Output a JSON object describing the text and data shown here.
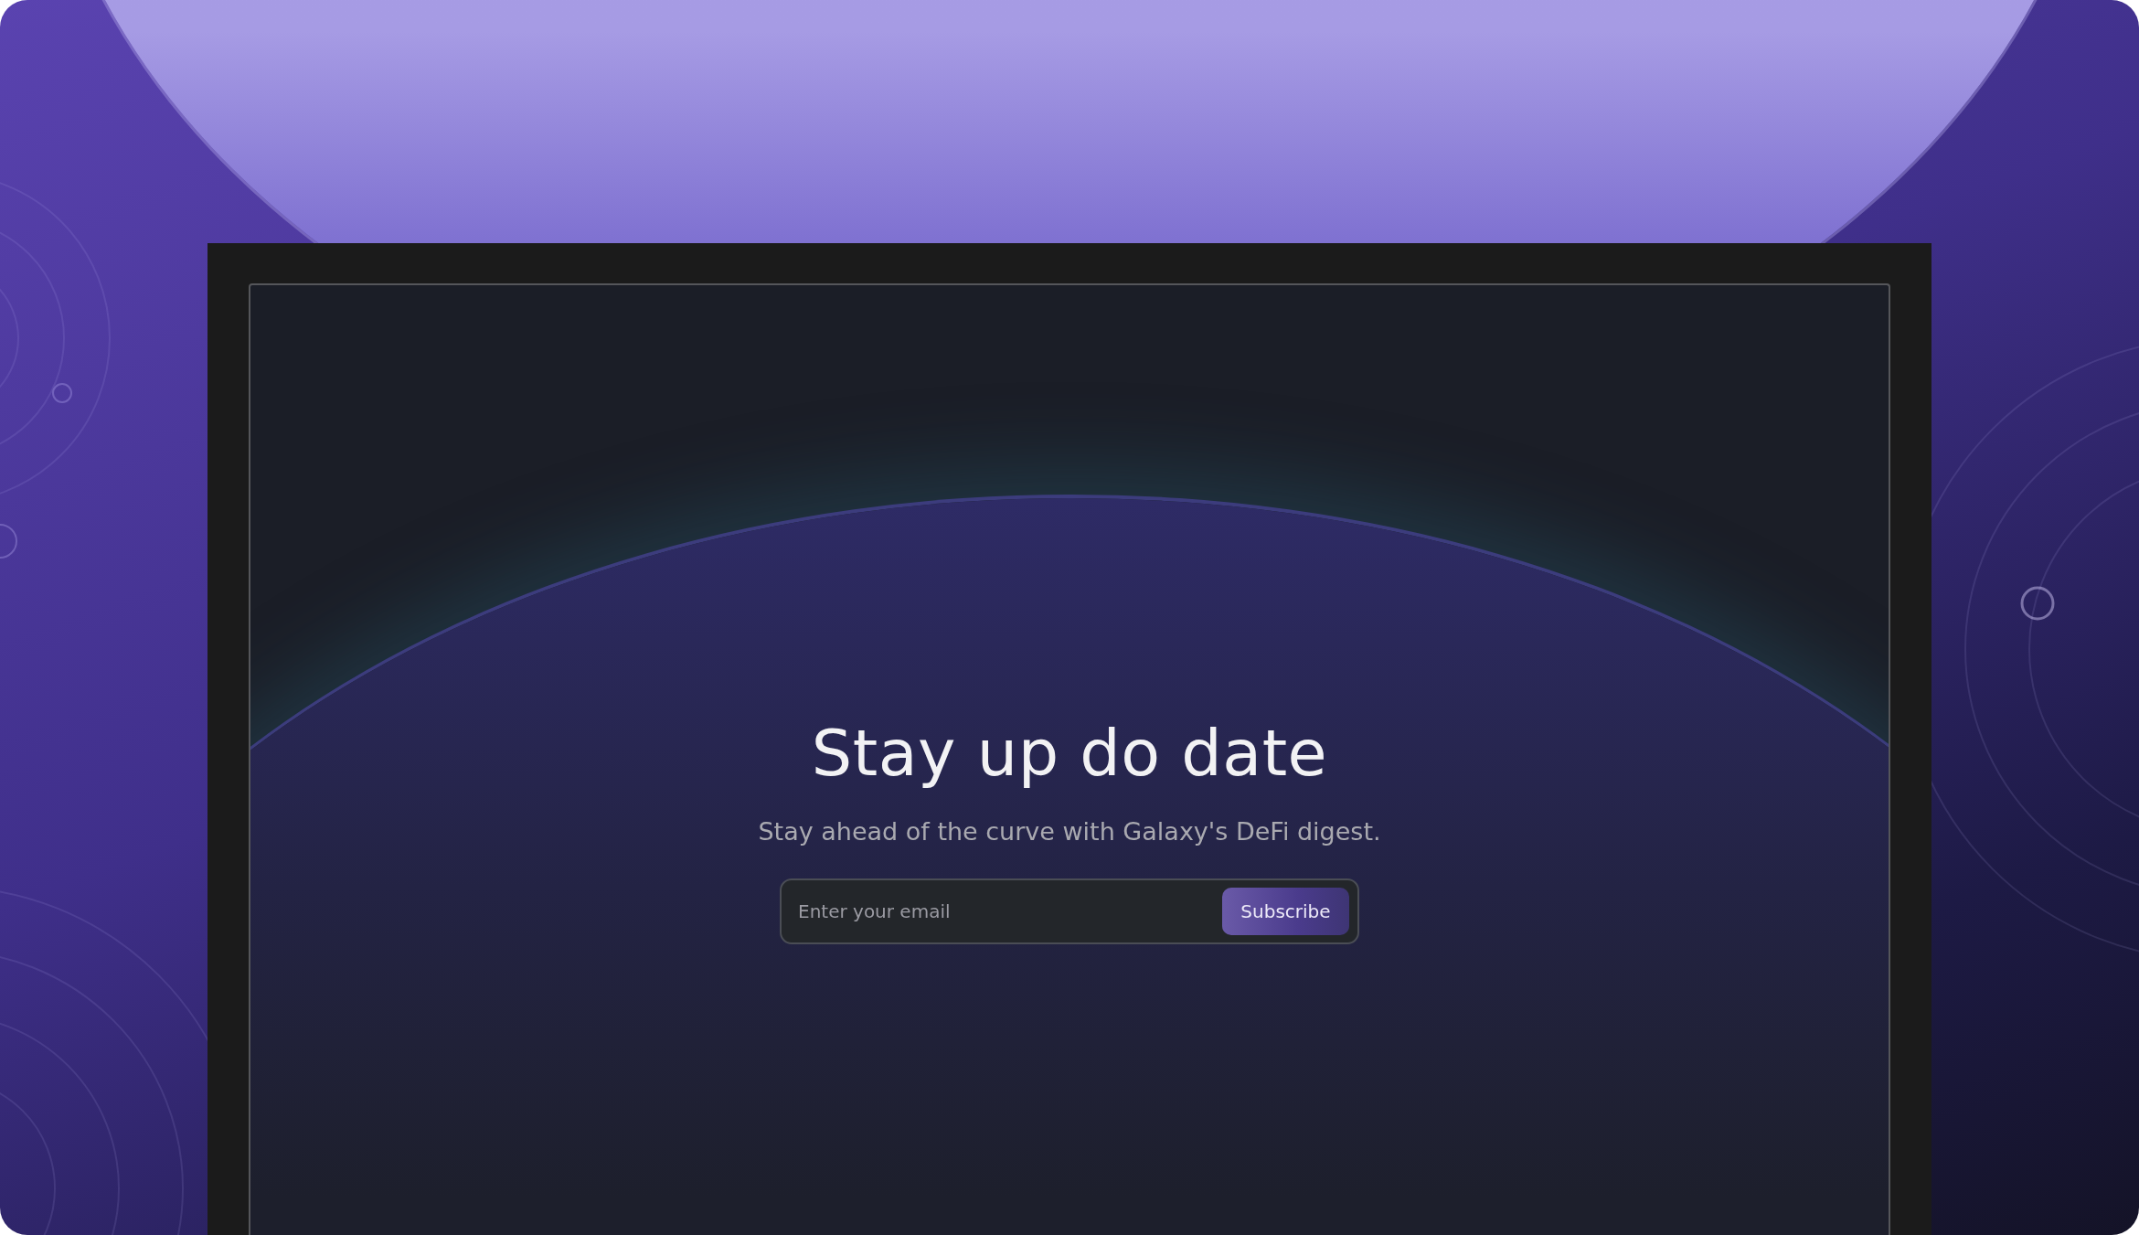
{
  "heading": "Stay up do date",
  "subtitle": "Stay ahead of the curve with Galaxy's DeFi digest.",
  "email_field": {
    "placeholder": "Enter your email"
  },
  "subscribe_button": {
    "label": "Subscribe"
  }
}
